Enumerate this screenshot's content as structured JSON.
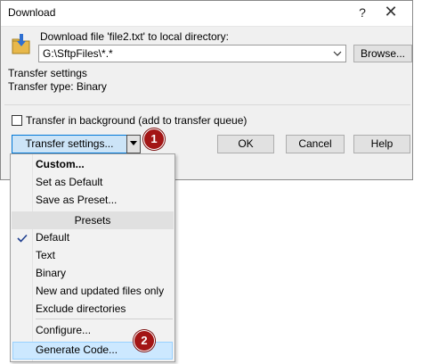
{
  "window": {
    "title": "Download",
    "help_glyph": "?",
    "close_glyph": "✕"
  },
  "dialog": {
    "prompt": "Download file 'file2.txt' to local directory:",
    "path_value": "G:\\SftpFiles\\*.*",
    "browse_label": "Browse...",
    "transfer_settings_group_title": "Transfer settings",
    "transfer_type": "Transfer type: Binary",
    "background_checkbox_label": "Transfer in background (add to transfer queue)",
    "background_checked": false,
    "transfer_settings_button": "Transfer settings...",
    "ok_label": "OK",
    "cancel_label": "Cancel",
    "help_label": "Help"
  },
  "callouts": {
    "first": "1",
    "second": "2"
  },
  "menu": {
    "items": [
      {
        "label": "Custom...",
        "bold": true
      },
      {
        "label": "Set as Default"
      },
      {
        "label": "Save as Preset..."
      },
      {
        "label": "Presets",
        "header": true
      },
      {
        "label": "Default",
        "checked": true
      },
      {
        "label": "Text"
      },
      {
        "label": "Binary"
      },
      {
        "label": "New and updated files only"
      },
      {
        "label": "Exclude directories"
      },
      {
        "label": "Configure..."
      },
      {
        "label": "Generate Code...",
        "highlighted": true
      }
    ]
  },
  "colors": {
    "accent_blue": "#0078d7",
    "callout_red": "#a31515",
    "highlight": "#cce8ff"
  },
  "icons": {
    "dialog": "folder-download-icon",
    "checked": "check-icon",
    "combo_arrow": "chevron-down-icon",
    "split_arrow": "triangle-down-icon"
  }
}
